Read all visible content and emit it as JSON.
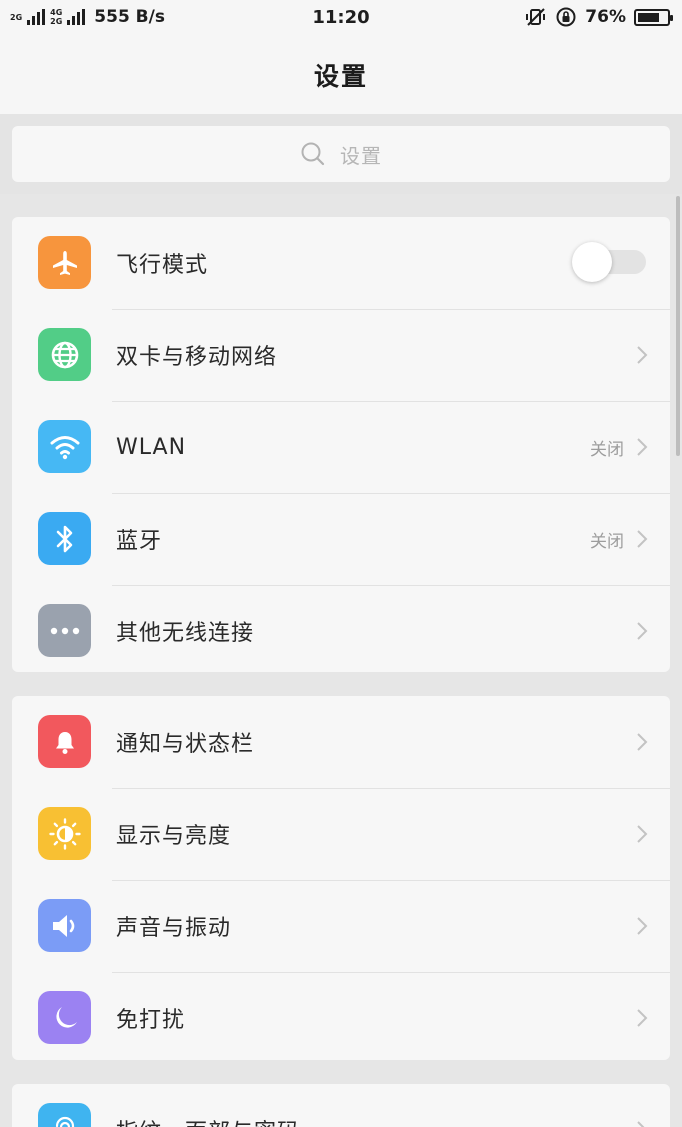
{
  "status_bar": {
    "net1": "2G",
    "net2_top": "4G",
    "net2_bottom": "2G",
    "speed": "555 B/s",
    "time": "11:20",
    "battery_pct": "76%",
    "battery_level": 0.76
  },
  "header": {
    "title": "设置"
  },
  "search": {
    "placeholder": "设置"
  },
  "groups": [
    {
      "items": [
        {
          "label": "飞行模式",
          "icon": "airplane-icon",
          "color": "#f7953d",
          "control": "toggle",
          "toggle_on": false
        },
        {
          "label": "双卡与移动网络",
          "icon": "globe-icon",
          "color": "#52cd87",
          "control": "chevron"
        },
        {
          "label": "WLAN",
          "value": "关闭",
          "icon": "wifi-icon",
          "color": "#46b8f4",
          "control": "chevron"
        },
        {
          "label": "蓝牙",
          "value": "关闭",
          "icon": "bluetooth-icon",
          "color": "#3aaaf2",
          "control": "chevron"
        },
        {
          "label": "其他无线连接",
          "icon": "more-dots-icon",
          "color": "#9aa2ae",
          "control": "chevron"
        }
      ]
    },
    {
      "items": [
        {
          "label": "通知与状态栏",
          "icon": "bell-icon",
          "color": "#f2585d",
          "control": "chevron"
        },
        {
          "label": "显示与亮度",
          "icon": "brightness-icon",
          "color": "#f8c033",
          "control": "chevron"
        },
        {
          "label": "声音与振动",
          "icon": "speaker-icon",
          "color": "#7b9cf6",
          "control": "chevron"
        },
        {
          "label": "免打扰",
          "icon": "moon-icon",
          "color": "#9b82f2",
          "control": "chevron"
        }
      ]
    },
    {
      "items": [
        {
          "label": "指纹、面部与密码",
          "icon": "fingerprint-icon",
          "color": "#3fb4f0",
          "control": "chevron"
        }
      ]
    }
  ]
}
